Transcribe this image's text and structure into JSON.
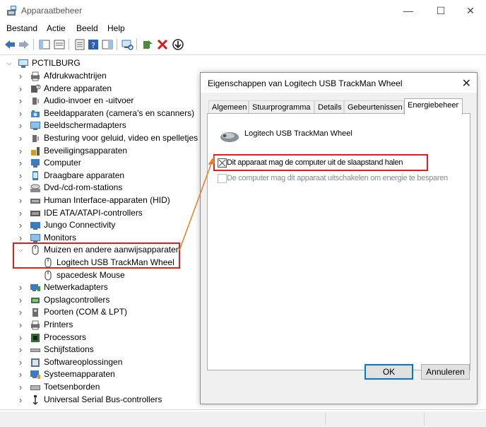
{
  "window": {
    "title": "Apparaatbeheer",
    "minimize": "—",
    "maximize": "☐",
    "close": "✕"
  },
  "menu": [
    "Bestand",
    "Actie",
    "Beeld",
    "Help"
  ],
  "tree": {
    "root": "PCTILBURG",
    "items": [
      "Afdrukwachtrijen",
      "Andere apparaten",
      "Audio-invoer en -uitvoer",
      "Beeldapparaten (camera's en scanners)",
      "Beeldschermadapters",
      "Besturing voor geluid, video en spelletjes",
      "Beveiligingsapparaten",
      "Computer",
      "Draagbare apparaten",
      "Dvd-/cd-rom-stations",
      "Human Interface-apparaten (HID)",
      "IDE ATA/ATAPI-controllers",
      "Jungo Connectivity",
      "Monitors",
      "Muizen en andere aanwijsapparaten",
      "Logitech USB TrackMan Wheel",
      "spacedesk Mouse",
      "Netwerkadapters",
      "Opslagcontrollers",
      "Poorten (COM & LPT)",
      "Printers",
      "Processors",
      "Schijfstations",
      "Softwareoplossingen",
      "Systeemapparaten",
      "Toetsenborden",
      "Universal Serial Bus-controllers"
    ]
  },
  "dialog": {
    "title": "Eigenschappen van Logitech USB TrackMan Wheel",
    "close": "✕",
    "tabs": [
      "Algemeen",
      "Stuurprogramma",
      "Details",
      "Gebeurtenissen",
      "Energiebeheer"
    ],
    "active_tab": "Energiebeheer",
    "device_name": "Logitech USB TrackMan Wheel",
    "options": [
      {
        "label": "Dit apparaat mag de computer uit de slaapstand halen",
        "checked": true,
        "enabled": true
      },
      {
        "label": "De computer mag dit apparaat uitschakelen om energie te besparen",
        "checked": false,
        "enabled": false
      }
    ],
    "ok": "OK",
    "cancel": "Annuleren"
  },
  "colors": {
    "highlight": "#e02020",
    "arrow": "#f07820",
    "accent": "#0078d7"
  }
}
